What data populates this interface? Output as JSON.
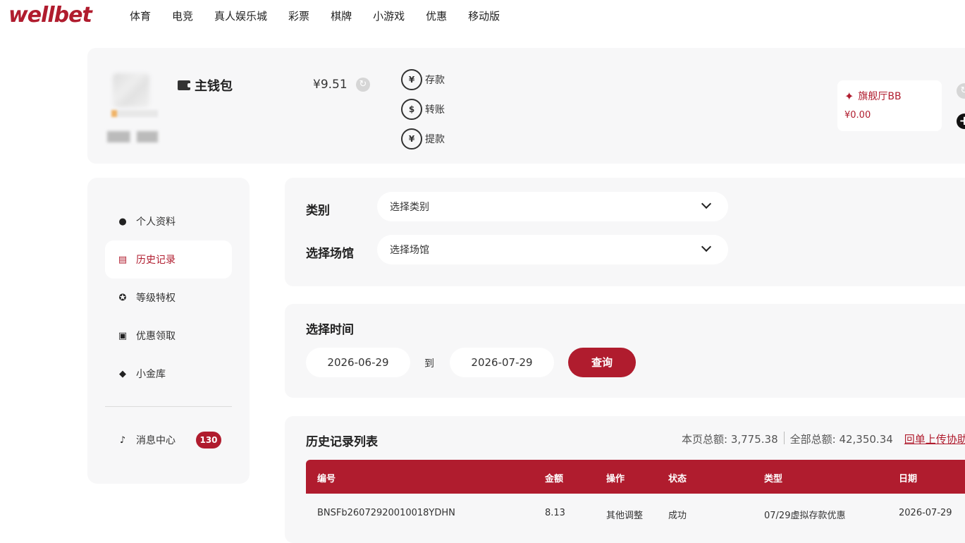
{
  "brand": {
    "logo": "wellbet",
    "accent": "#b01c2e"
  },
  "nav": {
    "items": [
      "体育",
      "电竞",
      "真人娱乐城",
      "彩票",
      "棋牌",
      "小游戏",
      "优惠",
      "移动版"
    ]
  },
  "wallet": {
    "title": "主钱包",
    "balance": "¥9.51",
    "actions": [
      {
        "label": "存款",
        "icon": "deposit-icon",
        "glyph": "¥"
      },
      {
        "label": "转账",
        "icon": "transfer-icon",
        "glyph": "$"
      },
      {
        "label": "提款",
        "icon": "withdraw-icon",
        "glyph": "¥"
      }
    ],
    "venue": {
      "name": "旗舰厅BB",
      "amount": "¥0.00",
      "icon": "eagle-icon"
    }
  },
  "sidebar": {
    "items": [
      {
        "label": "个人资料",
        "icon": "user-icon",
        "glyph": "●"
      },
      {
        "label": "历史记录",
        "icon": "document-icon",
        "glyph": "▤",
        "active": true
      },
      {
        "label": "等级特权",
        "icon": "medal-icon",
        "glyph": "✪"
      },
      {
        "label": "优惠领取",
        "icon": "gift-icon",
        "glyph": "▣"
      },
      {
        "label": "小金库",
        "icon": "diamond-icon",
        "glyph": "◆"
      }
    ],
    "messages": {
      "label": "消息中心",
      "icon": "bell-icon",
      "glyph": "♪",
      "count": "130"
    }
  },
  "filters": {
    "category_label": "类别",
    "category_placeholder": "选择类别",
    "venue_label": "选择场馆",
    "venue_placeholder": "选择场馆"
  },
  "time": {
    "label": "选择时间",
    "start": "2026-06-29",
    "to": "到",
    "end": "2026-07-29",
    "query": "查询"
  },
  "history": {
    "title": "历史记录列表",
    "page_total": "本页总额: 3,775.38",
    "all_total": "全部总额: 42,350.34",
    "link": "回单上传协助",
    "columns": [
      "编号",
      "金额",
      "操作",
      "状态",
      "类型",
      "日期"
    ],
    "rows": [
      [
        "BNSFb26072920010018YDHN",
        "8.13",
        "其他调整",
        "成功",
        "07/29虚拟存款优惠",
        "2026-07-29"
      ]
    ]
  }
}
